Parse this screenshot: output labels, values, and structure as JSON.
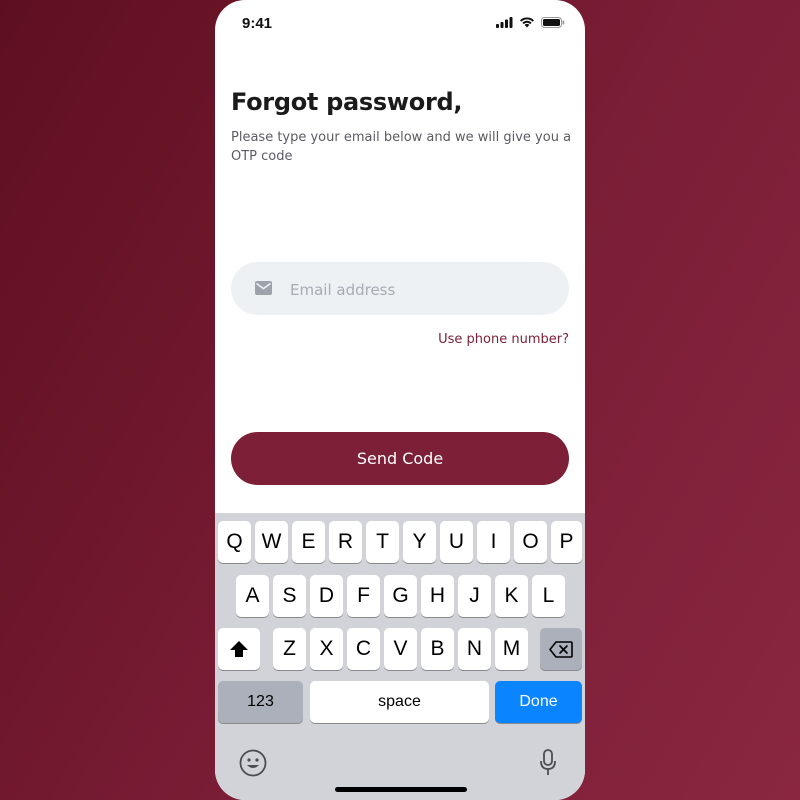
{
  "status_bar": {
    "time": "9:41"
  },
  "header": {
    "title": "Forgot password,",
    "subtitle": "Please type your email below and we will give you a OTP code"
  },
  "email_field": {
    "placeholder": "Email address",
    "value": "",
    "icon": "mail-icon"
  },
  "phone_link": "Use phone number?",
  "send_button": "Send Code",
  "colors": {
    "brand": "#7d1f36",
    "field_bg": "#eef1f4",
    "done_key": "#0a84ff"
  },
  "keyboard": {
    "row1": [
      "Q",
      "W",
      "E",
      "R",
      "T",
      "Y",
      "U",
      "I",
      "O",
      "P"
    ],
    "row2": [
      "A",
      "S",
      "D",
      "F",
      "G",
      "H",
      "J",
      "K",
      "L"
    ],
    "row3": [
      "Z",
      "X",
      "C",
      "V",
      "B",
      "N",
      "M"
    ],
    "numbers_key": "123",
    "space_key": "space",
    "done_key": "Done",
    "icons": [
      "shift-icon",
      "backspace-icon",
      "emoji-icon",
      "microphone-icon"
    ]
  }
}
